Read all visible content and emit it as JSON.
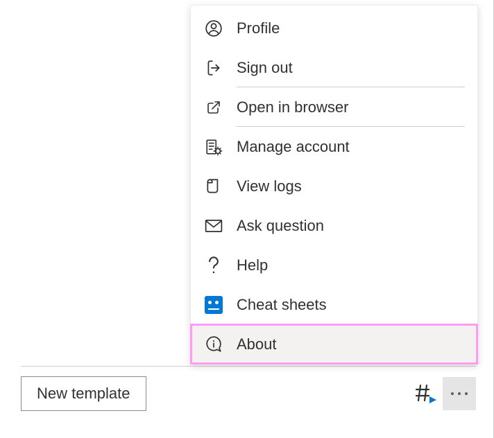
{
  "bottom_bar": {
    "new_template_label": "New template"
  },
  "menu": {
    "items": [
      {
        "label": "Profile"
      },
      {
        "label": "Sign out"
      },
      {
        "label": "Open in browser"
      },
      {
        "label": "Manage account"
      },
      {
        "label": "View logs"
      },
      {
        "label": "Ask question"
      },
      {
        "label": "Help"
      },
      {
        "label": "Cheat sheets"
      },
      {
        "label": "About"
      }
    ]
  },
  "colors": {
    "highlight_outline": "#ff9bf0",
    "accent": "#0078d4"
  }
}
